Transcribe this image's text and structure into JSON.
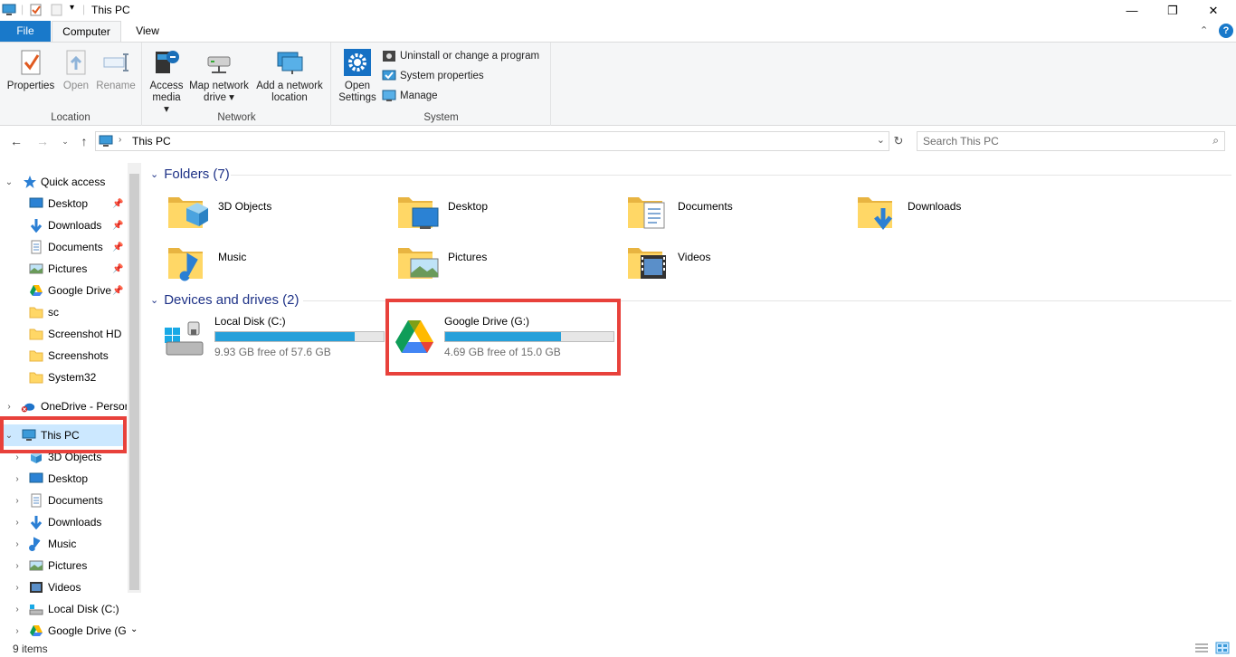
{
  "window": {
    "title": "This PC"
  },
  "ribbon": {
    "tabs": [
      "File",
      "Computer",
      "View"
    ],
    "location_group": {
      "label": "Location",
      "properties": "Properties",
      "open": "Open",
      "rename": "Rename"
    },
    "network_group": {
      "label": "Network",
      "access_media_1": "Access",
      "access_media_2": "media ▾",
      "map_drive_1": "Map network",
      "map_drive_2": "drive ▾",
      "add_location_1": "Add a network",
      "add_location_2": "location"
    },
    "system_group": {
      "label": "System",
      "open_settings_1": "Open",
      "open_settings_2": "Settings",
      "uninstall": "Uninstall or change a program",
      "system_properties": "System properties",
      "manage": "Manage"
    }
  },
  "address": {
    "path": "This PC",
    "search_placeholder": "Search This PC"
  },
  "nav": {
    "quick_access": "Quick access",
    "qa_items": [
      "Desktop",
      "Downloads",
      "Documents",
      "Pictures",
      "Google Drive",
      "sc",
      "Screenshot HD",
      "Screenshots",
      "System32"
    ],
    "onedrive": "OneDrive - Persor",
    "this_pc": "This PC",
    "pc_items": [
      "3D Objects",
      "Desktop",
      "Documents",
      "Downloads",
      "Music",
      "Pictures",
      "Videos",
      "Local Disk (C:)",
      "Google Drive (G:"
    ]
  },
  "content": {
    "folders_header": "Folders (7)",
    "folders": [
      "3D Objects",
      "Desktop",
      "Documents",
      "Downloads",
      "Music",
      "Pictures",
      "Videos"
    ],
    "drives_header": "Devices and drives (2)",
    "drives": [
      {
        "name": "Local Disk (C:)",
        "free": "9.93 GB free of 57.6 GB",
        "used_fraction": 0.83
      },
      {
        "name": "Google Drive (G:)",
        "free": "4.69 GB free of 15.0 GB",
        "used_fraction": 0.69
      }
    ]
  },
  "status": {
    "items": "9 items"
  },
  "colors": {
    "accent": "#1979ca",
    "highlight": "#e8413b",
    "drive_bar": "#26a0da"
  }
}
